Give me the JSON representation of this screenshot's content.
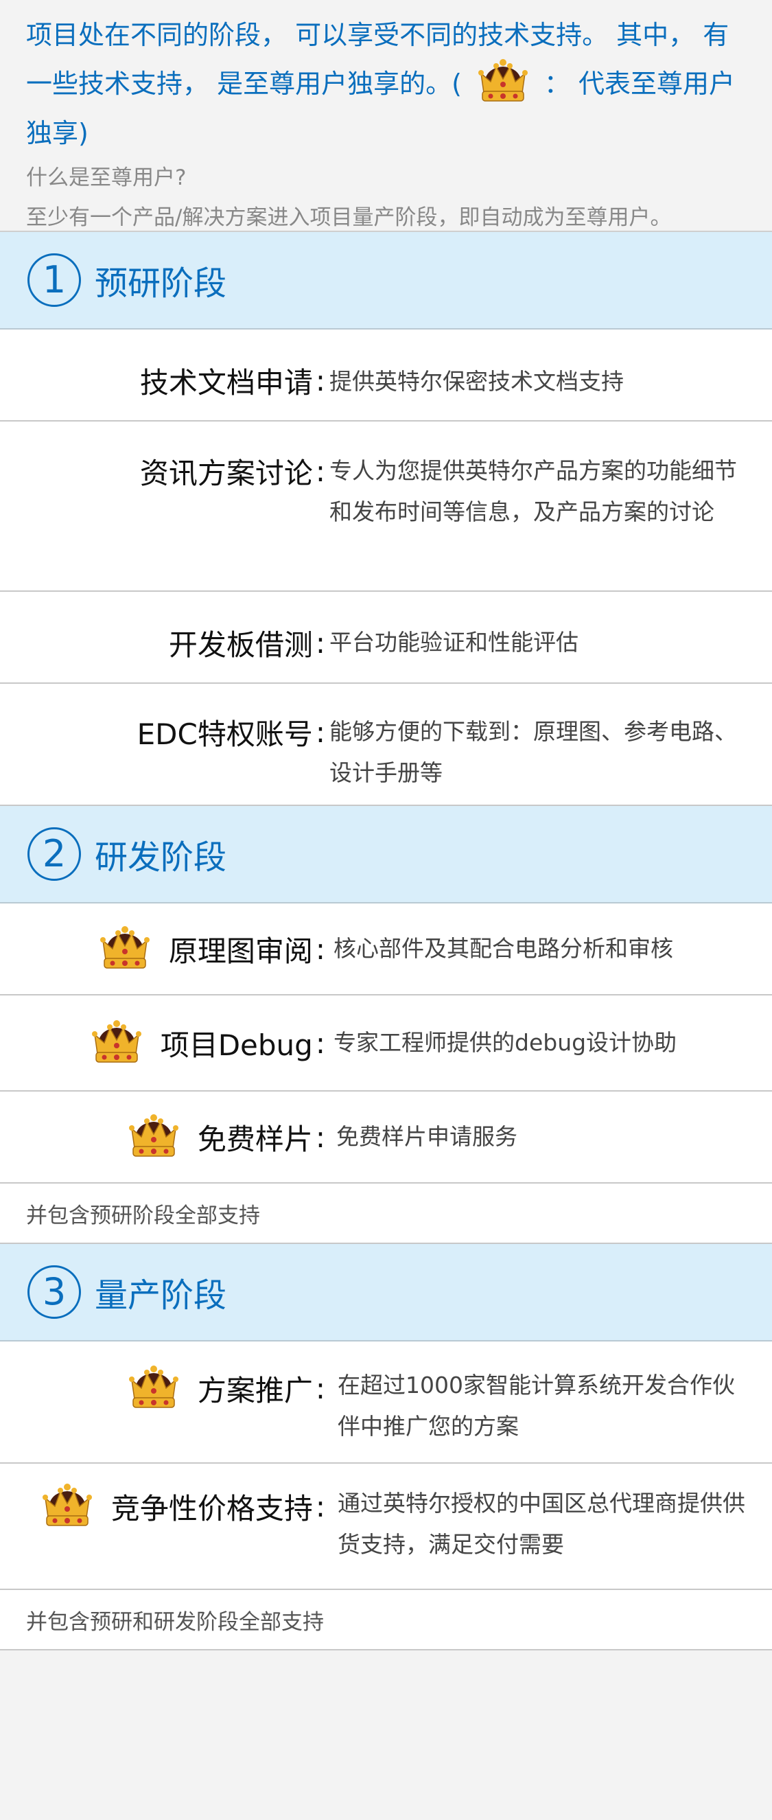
{
  "intro": {
    "text_before_crown": "项目处在不同的阶段， 可以享受不同的技术支持。 其中， 有一些技术支持， 是至尊用户独享的。(",
    "text_after_crown": "： 代表至尊用户独享)",
    "crown_icon": "crown-icon",
    "question": "什么是至尊用户?",
    "answer": "至少有一个产品/解决方案进入项目量产阶段，即自动成为至尊用户。"
  },
  "stages": [
    {
      "number": "1",
      "title": "预研阶段",
      "rows": [
        {
          "label": "技术文档申请",
          "colon": ":",
          "exclusive": false,
          "desc": "提供英特尔保密技术文档支持"
        },
        {
          "label": "资讯方案讨论",
          "colon": ":",
          "exclusive": false,
          "desc": "专人为您提供英特尔产品方案的功能细节和发布时间等信息，及产品方案的讨论"
        },
        {
          "label": "开发板借测",
          "colon": ":",
          "exclusive": false,
          "desc": "平台功能验证和性能评估"
        },
        {
          "label": "EDC特权账号",
          "colon": ":",
          "exclusive": false,
          "desc": "能够方便的下载到：原理图、参考电路、设计手册等"
        }
      ],
      "note": ""
    },
    {
      "number": "2",
      "title": "研发阶段",
      "rows": [
        {
          "label": "原理图审阅",
          "colon": ":",
          "exclusive": true,
          "desc": "核心部件及其配合电路分析和审核"
        },
        {
          "label": "项目Debug",
          "colon": ":",
          "exclusive": true,
          "desc": "专家工程师提供的debug设计协助"
        },
        {
          "label": "免费样片",
          "colon": ":",
          "exclusive": true,
          "desc": "免费样片申请服务"
        }
      ],
      "note": "并包含预研阶段全部支持"
    },
    {
      "number": "3",
      "title": "量产阶段",
      "rows": [
        {
          "label": "方案推广",
          "colon": ":",
          "exclusive": true,
          "desc": "在超过1000家智能计算系统开发合作伙伴中推广您的方案"
        },
        {
          "label": "竞争性价格支持",
          "colon": ":",
          "exclusive": true,
          "desc": "通过英特尔授权的中国区总代理商提供供货支持，满足交付需要"
        }
      ],
      "note": "并包含预研和研发阶段全部支持"
    }
  ],
  "colors": {
    "accent": "#0a6ebd",
    "stage_header_bg": "#d9eefa",
    "crown_gold": "#f0b32b",
    "crown_red": "#c8342b",
    "crown_dark": "#4a1d10"
  }
}
